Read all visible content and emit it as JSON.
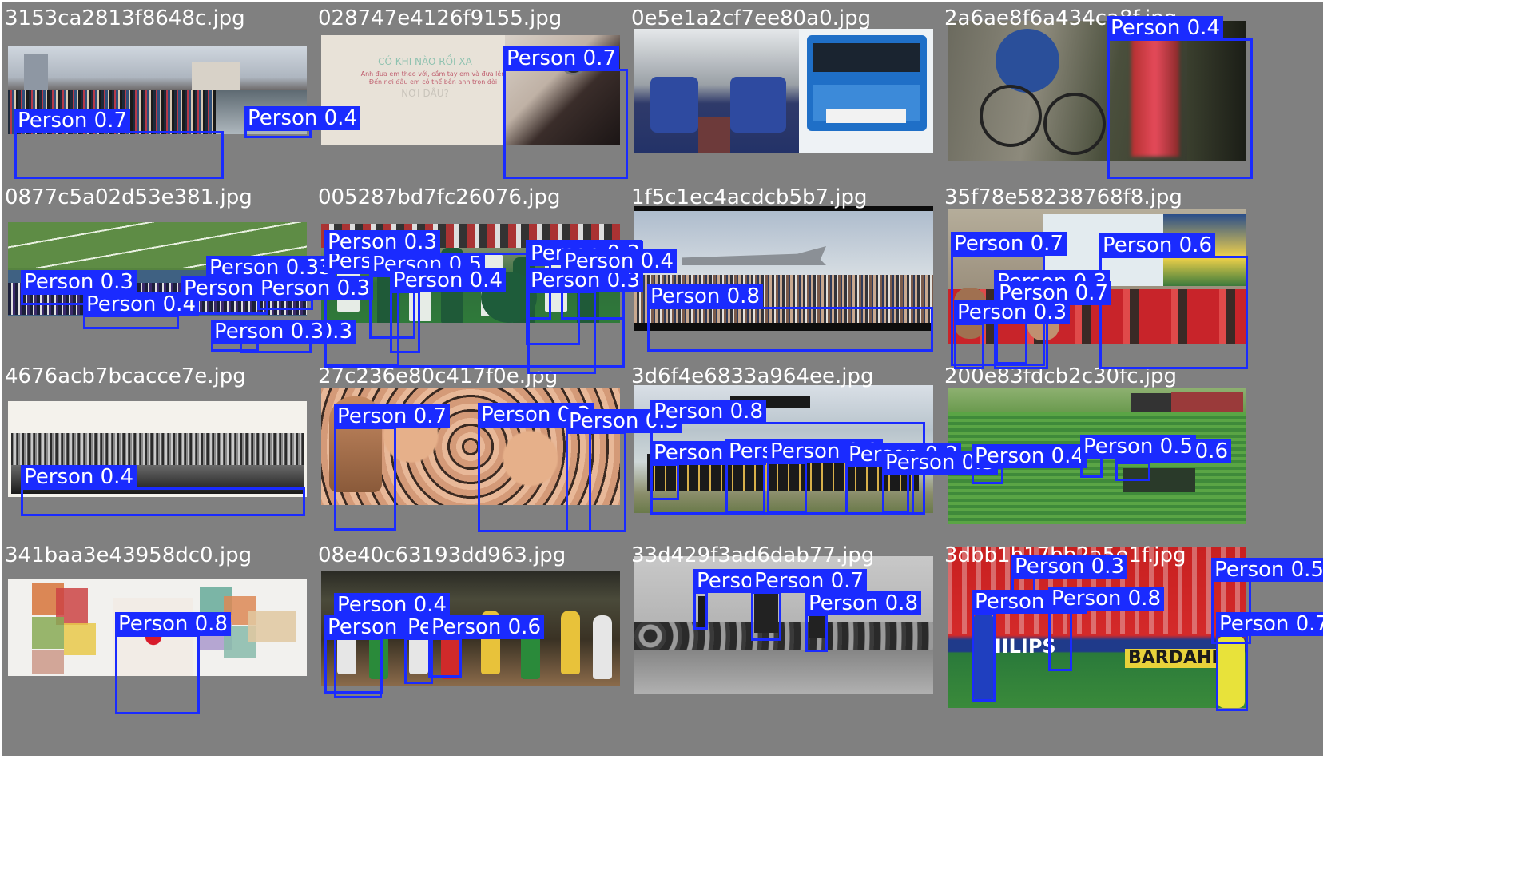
{
  "colors": {
    "tile_bg": "#808080",
    "box": "#1a2bff",
    "label_text": "#ffffff"
  },
  "tiles": [
    {
      "filename": "3153ca2813f8648c.jpg",
      "scene": "crowd-street",
      "detections": [
        {
          "label": "Person 0.7"
        },
        {
          "label": "Person 0.4"
        }
      ]
    },
    {
      "filename": "028747e4126f9155.jpg",
      "scene": "girl-headphones",
      "overlay_text": [
        "CÓ KHI NÀO RỒI XA",
        "Anh đưa em theo với, cầm tay em và đưa lên",
        "Đến nơi đâu em có thể bên anh trọn đời",
        "NƠI ĐÂU?"
      ],
      "detections": [
        {
          "label": "Person 0.7"
        }
      ]
    },
    {
      "filename": "0e5e1a2cf7ee80a0.jpg",
      "scene": "bus",
      "detections": []
    },
    {
      "filename": "2a6ae8f6a434ca8f.jpg",
      "scene": "mountain-bike",
      "detections": [
        {
          "label": "Person 0.4"
        }
      ]
    },
    {
      "filename": "0877c5a02d53e381.jpg",
      "scene": "marching-band",
      "detections": [
        {
          "label": "Person 0.3"
        },
        {
          "label": "Person 0.33"
        },
        {
          "label": "Person 0.4"
        },
        {
          "label": "Person 0.3"
        },
        {
          "label": "Person 0.3"
        },
        {
          "label": "Person 0.3"
        },
        {
          "label": "Person 0.3"
        }
      ]
    },
    {
      "filename": "005287bd7fc26076.jpg",
      "scene": "lacrosse",
      "detections": [
        {
          "label": "Person 0.3"
        },
        {
          "label": "Person 0.5"
        },
        {
          "label": "Person 0.4"
        },
        {
          "label": "Person 0.3"
        },
        {
          "label": "Person 0.3"
        },
        {
          "label": "Person 0.3"
        },
        {
          "label": "Person 0.3"
        },
        {
          "label": "Person 0.4"
        }
      ]
    },
    {
      "filename": "1f5c1ec4acdcb5b7.jpg",
      "scene": "airshow-crowd",
      "detections": [
        {
          "label": "Person 0.8"
        }
      ]
    },
    {
      "filename": "35f78e58238768f8.jpg",
      "scene": "lecture-room",
      "detections": [
        {
          "label": "Person 0.7"
        },
        {
          "label": "Person 0.6"
        },
        {
          "label": "Person 0.3"
        },
        {
          "label": "Person 0.7"
        },
        {
          "label": "Person 0.3"
        }
      ]
    },
    {
      "filename": "4676acb7bcacce7e.jpg",
      "scene": "panorama-photo",
      "detections": [
        {
          "label": "Person 0.4"
        }
      ]
    },
    {
      "filename": "27c236e80c417f0e.jpg",
      "scene": "warped-face",
      "detections": [
        {
          "label": "Person 0.7"
        },
        {
          "label": "Person 0.3"
        },
        {
          "label": "Person 0.3"
        }
      ]
    },
    {
      "filename": "3d6f4e6833a964ee.jpg",
      "scene": "group-photo",
      "detections": [
        {
          "label": "Person 0.8"
        },
        {
          "label": "Person 0.3"
        },
        {
          "label": "Person 0.3"
        },
        {
          "label": "Person 0.3"
        },
        {
          "label": "Person 0.3"
        },
        {
          "label": "Person 0.3"
        }
      ]
    },
    {
      "filename": "200e83fdcb2c30fc.jpg",
      "scene": "tractor-field",
      "detections": [
        {
          "label": "Person 0.4"
        },
        {
          "label": "Person 0.6"
        },
        {
          "label": "Person 0.5"
        }
      ]
    },
    {
      "filename": "341baa3e43958dc0.jpg",
      "scene": "photo-wall",
      "detections": [
        {
          "label": "Person 0.8"
        }
      ]
    },
    {
      "filename": "08e40c63193dd963.jpg",
      "scene": "dancers",
      "detections": [
        {
          "label": "Person 0.4"
        },
        {
          "label": "Person 0.4"
        },
        {
          "label": "Person 0.5"
        },
        {
          "label": "Person 0.6"
        }
      ]
    },
    {
      "filename": "33d429f3ad6dab77.jpg",
      "scene": "bw-rocks",
      "detections": [
        {
          "label": "Person 0.6"
        },
        {
          "label": "Person 0.7"
        },
        {
          "label": "Person 0.8"
        }
      ]
    },
    {
      "filename": "3dbb1b17bb2a5e1f.jpg",
      "scene": "football",
      "overlay_text": [
        "PHILIPS",
        "BARDAHL"
      ],
      "detections": [
        {
          "label": "Person 0.3"
        },
        {
          "label": "Person 0.8"
        },
        {
          "label": "Person 0.8"
        },
        {
          "label": "Person 0.5"
        },
        {
          "label": "Person 0.7"
        },
        {
          "label": "Person 0.4"
        }
      ]
    }
  ]
}
